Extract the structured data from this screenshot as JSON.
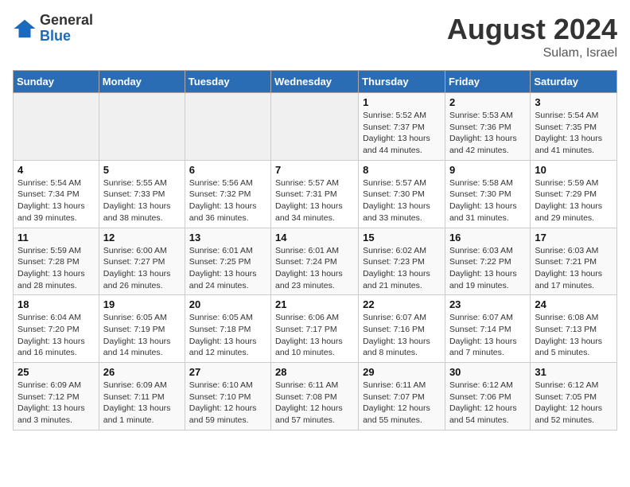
{
  "logo": {
    "general": "General",
    "blue": "Blue"
  },
  "title": "August 2024",
  "location": "Sulam, Israel",
  "weekdays": [
    "Sunday",
    "Monday",
    "Tuesday",
    "Wednesday",
    "Thursday",
    "Friday",
    "Saturday"
  ],
  "weeks": [
    [
      {
        "day": "",
        "info": ""
      },
      {
        "day": "",
        "info": ""
      },
      {
        "day": "",
        "info": ""
      },
      {
        "day": "",
        "info": ""
      },
      {
        "day": "1",
        "info": "Sunrise: 5:52 AM\nSunset: 7:37 PM\nDaylight: 13 hours\nand 44 minutes."
      },
      {
        "day": "2",
        "info": "Sunrise: 5:53 AM\nSunset: 7:36 PM\nDaylight: 13 hours\nand 42 minutes."
      },
      {
        "day": "3",
        "info": "Sunrise: 5:54 AM\nSunset: 7:35 PM\nDaylight: 13 hours\nand 41 minutes."
      }
    ],
    [
      {
        "day": "4",
        "info": "Sunrise: 5:54 AM\nSunset: 7:34 PM\nDaylight: 13 hours\nand 39 minutes."
      },
      {
        "day": "5",
        "info": "Sunrise: 5:55 AM\nSunset: 7:33 PM\nDaylight: 13 hours\nand 38 minutes."
      },
      {
        "day": "6",
        "info": "Sunrise: 5:56 AM\nSunset: 7:32 PM\nDaylight: 13 hours\nand 36 minutes."
      },
      {
        "day": "7",
        "info": "Sunrise: 5:57 AM\nSunset: 7:31 PM\nDaylight: 13 hours\nand 34 minutes."
      },
      {
        "day": "8",
        "info": "Sunrise: 5:57 AM\nSunset: 7:30 PM\nDaylight: 13 hours\nand 33 minutes."
      },
      {
        "day": "9",
        "info": "Sunrise: 5:58 AM\nSunset: 7:30 PM\nDaylight: 13 hours\nand 31 minutes."
      },
      {
        "day": "10",
        "info": "Sunrise: 5:59 AM\nSunset: 7:29 PM\nDaylight: 13 hours\nand 29 minutes."
      }
    ],
    [
      {
        "day": "11",
        "info": "Sunrise: 5:59 AM\nSunset: 7:28 PM\nDaylight: 13 hours\nand 28 minutes."
      },
      {
        "day": "12",
        "info": "Sunrise: 6:00 AM\nSunset: 7:27 PM\nDaylight: 13 hours\nand 26 minutes."
      },
      {
        "day": "13",
        "info": "Sunrise: 6:01 AM\nSunset: 7:25 PM\nDaylight: 13 hours\nand 24 minutes."
      },
      {
        "day": "14",
        "info": "Sunrise: 6:01 AM\nSunset: 7:24 PM\nDaylight: 13 hours\nand 23 minutes."
      },
      {
        "day": "15",
        "info": "Sunrise: 6:02 AM\nSunset: 7:23 PM\nDaylight: 13 hours\nand 21 minutes."
      },
      {
        "day": "16",
        "info": "Sunrise: 6:03 AM\nSunset: 7:22 PM\nDaylight: 13 hours\nand 19 minutes."
      },
      {
        "day": "17",
        "info": "Sunrise: 6:03 AM\nSunset: 7:21 PM\nDaylight: 13 hours\nand 17 minutes."
      }
    ],
    [
      {
        "day": "18",
        "info": "Sunrise: 6:04 AM\nSunset: 7:20 PM\nDaylight: 13 hours\nand 16 minutes."
      },
      {
        "day": "19",
        "info": "Sunrise: 6:05 AM\nSunset: 7:19 PM\nDaylight: 13 hours\nand 14 minutes."
      },
      {
        "day": "20",
        "info": "Sunrise: 6:05 AM\nSunset: 7:18 PM\nDaylight: 13 hours\nand 12 minutes."
      },
      {
        "day": "21",
        "info": "Sunrise: 6:06 AM\nSunset: 7:17 PM\nDaylight: 13 hours\nand 10 minutes."
      },
      {
        "day": "22",
        "info": "Sunrise: 6:07 AM\nSunset: 7:16 PM\nDaylight: 13 hours\nand 8 minutes."
      },
      {
        "day": "23",
        "info": "Sunrise: 6:07 AM\nSunset: 7:14 PM\nDaylight: 13 hours\nand 7 minutes."
      },
      {
        "day": "24",
        "info": "Sunrise: 6:08 AM\nSunset: 7:13 PM\nDaylight: 13 hours\nand 5 minutes."
      }
    ],
    [
      {
        "day": "25",
        "info": "Sunrise: 6:09 AM\nSunset: 7:12 PM\nDaylight: 13 hours\nand 3 minutes."
      },
      {
        "day": "26",
        "info": "Sunrise: 6:09 AM\nSunset: 7:11 PM\nDaylight: 13 hours\nand 1 minute."
      },
      {
        "day": "27",
        "info": "Sunrise: 6:10 AM\nSunset: 7:10 PM\nDaylight: 12 hours\nand 59 minutes."
      },
      {
        "day": "28",
        "info": "Sunrise: 6:11 AM\nSunset: 7:08 PM\nDaylight: 12 hours\nand 57 minutes."
      },
      {
        "day": "29",
        "info": "Sunrise: 6:11 AM\nSunset: 7:07 PM\nDaylight: 12 hours\nand 55 minutes."
      },
      {
        "day": "30",
        "info": "Sunrise: 6:12 AM\nSunset: 7:06 PM\nDaylight: 12 hours\nand 54 minutes."
      },
      {
        "day": "31",
        "info": "Sunrise: 6:12 AM\nSunset: 7:05 PM\nDaylight: 12 hours\nand 52 minutes."
      }
    ]
  ]
}
